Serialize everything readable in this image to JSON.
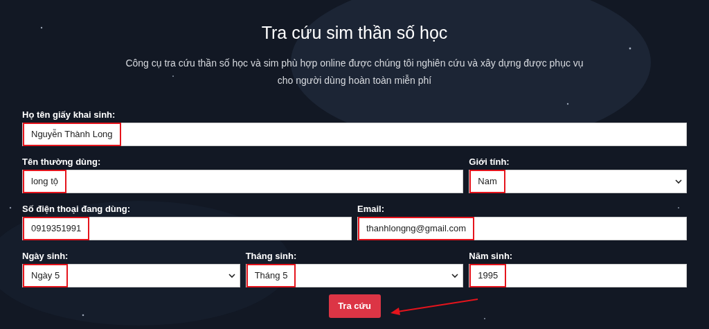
{
  "title": "Tra cứu sim thần số học",
  "subtitle": "Công cụ tra cứu thần số học và sim phù hợp online được chúng tôi nghiên cứu và xây dựng được phục vụ cho người dùng hoàn toàn miễn phí",
  "form_rows": [
    {
      "fields": [
        {
          "kind": "text",
          "label": "Họ tên giấy khai sinh:",
          "value": "Nguyễn Thành Long",
          "highlighted": true
        }
      ]
    },
    {
      "fields": [
        {
          "kind": "text",
          "label": "Tên thường dùng:",
          "value": "long tộ",
          "highlighted": true
        },
        {
          "kind": "select",
          "label": "Giới tính:",
          "value": "Nam",
          "highlighted": true
        }
      ]
    },
    {
      "fields": [
        {
          "kind": "text",
          "label": "Số điện thoại đang dùng:",
          "value": "0919351991",
          "highlighted": true
        },
        {
          "kind": "text",
          "label": "Email:",
          "value": "thanhlongng@gmail.com",
          "highlighted": true
        }
      ]
    },
    {
      "fields": [
        {
          "kind": "select",
          "label": "Ngày sinh:",
          "value": "Ngày 5",
          "highlighted": true
        },
        {
          "kind": "select",
          "label": "Tháng sinh:",
          "value": "Tháng 5",
          "highlighted": true
        },
        {
          "kind": "text",
          "label": "Năm sinh:",
          "value": "1995",
          "highlighted": true
        }
      ]
    }
  ],
  "submit_button": "Tra cứu"
}
